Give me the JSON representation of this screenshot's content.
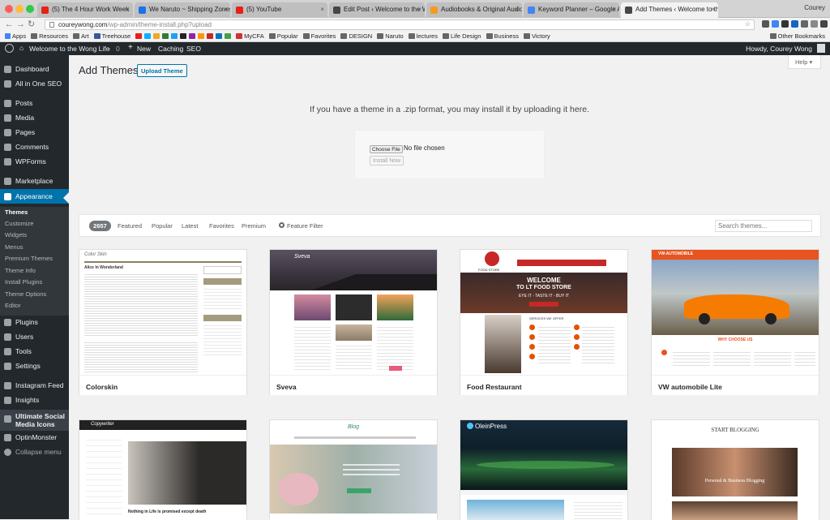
{
  "browser": {
    "tabs": [
      {
        "label": "(5) The 4 Hour Work Week",
        "color": "#e62117"
      },
      {
        "label": "We Naruto ~ Shipping Zones",
        "color": "#1a73e8"
      },
      {
        "label": "(5) YouTube",
        "color": "#e62117"
      },
      {
        "label": "Edit Post ‹ Welcome to the Wo",
        "color": "#464646"
      },
      {
        "label": "Audiobooks & Original Audio",
        "color": "#f7991c"
      },
      {
        "label": "Keyword Planner – Google Ad",
        "color": "#4285f4"
      },
      {
        "label": "Add Themes ‹ Welcome to th",
        "color": "#464646"
      }
    ],
    "profile": "Courey",
    "url_domain": "coureywong.com",
    "url_path": "/wp-admin/theme-install.php?upload",
    "bookmarks": [
      "Apps",
      "Resources",
      "Art",
      "Treehouse",
      "MyCFA",
      "Popular",
      "Favorites",
      "DESIGN",
      "Naruto",
      "lectures",
      "Life Design",
      "Business",
      "Victory"
    ],
    "other_bookmarks": "Other Bookmarks"
  },
  "adminbar": {
    "site_name": "Welcome to the Wong Life",
    "comments_count": "0",
    "new_label": "New",
    "caching_label": "Caching",
    "seo_label": "SEO",
    "howdy": "Howdy, Courey Wong"
  },
  "sidebar": {
    "items": [
      "Dashboard",
      "All in One SEO",
      "Posts",
      "Media",
      "Pages",
      "Comments",
      "WPForms",
      "Marketplace",
      "Appearance",
      "Plugins",
      "Users",
      "Tools",
      "Settings",
      "Instagram Feed",
      "Insights",
      "Ultimate Social Media Icons",
      "OptinMonster",
      "Collapse menu"
    ],
    "submenu": [
      "Themes",
      "Customize",
      "Widgets",
      "Menus",
      "Premium Themes",
      "Theme Info",
      "Install Plugins",
      "Theme Options",
      "Editor"
    ]
  },
  "main": {
    "title": "Add Themes",
    "upload_button": "Upload Theme",
    "help": "Help ▾",
    "upload_text": "If you have a theme in a .zip format, you may install it by uploading it here.",
    "choose_file": "Choose File",
    "no_file": "No file chosen",
    "install_now": "Install Now"
  },
  "filter": {
    "count": "2657",
    "tabs": [
      "Featured",
      "Popular",
      "Latest",
      "Favorites",
      "Premium"
    ],
    "feature_filter": "Feature Filter",
    "search_placeholder": "Search themes..."
  },
  "themes": [
    "Colorskin",
    "Sveva",
    "Food Restaurant",
    "VW automobile Lite"
  ],
  "previews": {
    "colorskin": {
      "logo": "Color Skin",
      "post": "Alice In Wonderland"
    },
    "sveva": {
      "logo": "Sveva"
    },
    "food": {
      "logo": "FOOD STORE",
      "headline": "WELCOME",
      "subhead": "TO LT FOOD STORE",
      "tagline": "EYE IT - TASTE IT - BUY IT",
      "section": "SERVICES WE OFFER"
    },
    "vw": {
      "logo": "VW-AUTOMOBILE",
      "heading": "WHY CHOOSE US"
    },
    "copywriter": {
      "logo": "Copywriter",
      "post": "Nothing in Life is promised except death"
    },
    "blog": {
      "logo": "Blog"
    },
    "oleinpress": {
      "logo": "OleinPress"
    },
    "startblogging": {
      "logo": "START BLOGGING",
      "banner": "Personal & Business Blogging"
    }
  }
}
